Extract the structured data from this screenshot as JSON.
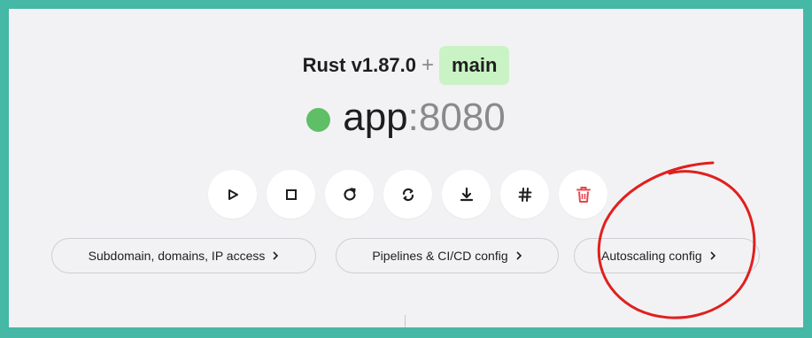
{
  "header": {
    "runtime": "Rust v1.87.0",
    "separator": "+",
    "branch": "main"
  },
  "app": {
    "name": "app",
    "port": ":8080",
    "status": "running",
    "status_color": "#5fbf66"
  },
  "actions": [
    {
      "icon": "play-icon"
    },
    {
      "icon": "stop-icon"
    },
    {
      "icon": "restart-icon"
    },
    {
      "icon": "redeploy-icon"
    },
    {
      "icon": "download-icon"
    },
    {
      "icon": "hash-icon"
    },
    {
      "icon": "trash-icon",
      "color": "#e5484d"
    }
  ],
  "links": {
    "domains": "Subdomain, domains, IP access",
    "pipelines": "Pipelines & CI/CD config",
    "autoscaling": "Autoscaling config"
  },
  "colors": {
    "background": "#46b8a6",
    "panel": "#f2f2f4",
    "branch_badge": "#c9f3c4",
    "annotation": "#e0201e"
  }
}
